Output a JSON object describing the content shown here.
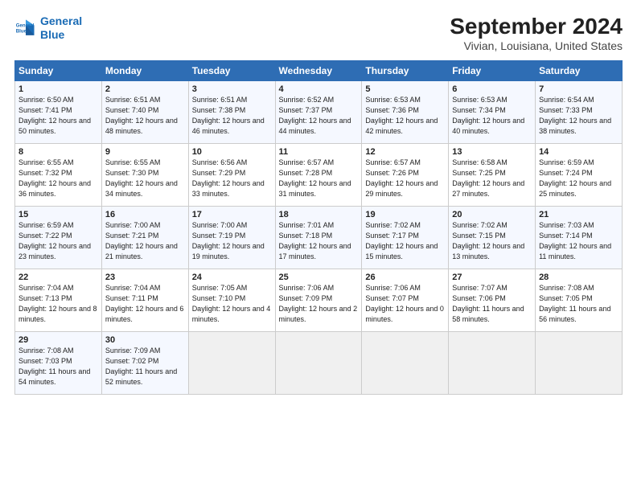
{
  "logo": {
    "line1": "General",
    "line2": "Blue"
  },
  "title": "September 2024",
  "subtitle": "Vivian, Louisiana, United States",
  "weekdays": [
    "Sunday",
    "Monday",
    "Tuesday",
    "Wednesday",
    "Thursday",
    "Friday",
    "Saturday"
  ],
  "weeks": [
    [
      {
        "day": "1",
        "sunrise": "6:50 AM",
        "sunset": "7:41 PM",
        "daylight": "12 hours and 50 minutes."
      },
      {
        "day": "2",
        "sunrise": "6:51 AM",
        "sunset": "7:40 PM",
        "daylight": "12 hours and 48 minutes."
      },
      {
        "day": "3",
        "sunrise": "6:51 AM",
        "sunset": "7:38 PM",
        "daylight": "12 hours and 46 minutes."
      },
      {
        "day": "4",
        "sunrise": "6:52 AM",
        "sunset": "7:37 PM",
        "daylight": "12 hours and 44 minutes."
      },
      {
        "day": "5",
        "sunrise": "6:53 AM",
        "sunset": "7:36 PM",
        "daylight": "12 hours and 42 minutes."
      },
      {
        "day": "6",
        "sunrise": "6:53 AM",
        "sunset": "7:34 PM",
        "daylight": "12 hours and 40 minutes."
      },
      {
        "day": "7",
        "sunrise": "6:54 AM",
        "sunset": "7:33 PM",
        "daylight": "12 hours and 38 minutes."
      }
    ],
    [
      {
        "day": "8",
        "sunrise": "6:55 AM",
        "sunset": "7:32 PM",
        "daylight": "12 hours and 36 minutes."
      },
      {
        "day": "9",
        "sunrise": "6:55 AM",
        "sunset": "7:30 PM",
        "daylight": "12 hours and 34 minutes."
      },
      {
        "day": "10",
        "sunrise": "6:56 AM",
        "sunset": "7:29 PM",
        "daylight": "12 hours and 33 minutes."
      },
      {
        "day": "11",
        "sunrise": "6:57 AM",
        "sunset": "7:28 PM",
        "daylight": "12 hours and 31 minutes."
      },
      {
        "day": "12",
        "sunrise": "6:57 AM",
        "sunset": "7:26 PM",
        "daylight": "12 hours and 29 minutes."
      },
      {
        "day": "13",
        "sunrise": "6:58 AM",
        "sunset": "7:25 PM",
        "daylight": "12 hours and 27 minutes."
      },
      {
        "day": "14",
        "sunrise": "6:59 AM",
        "sunset": "7:24 PM",
        "daylight": "12 hours and 25 minutes."
      }
    ],
    [
      {
        "day": "15",
        "sunrise": "6:59 AM",
        "sunset": "7:22 PM",
        "daylight": "12 hours and 23 minutes."
      },
      {
        "day": "16",
        "sunrise": "7:00 AM",
        "sunset": "7:21 PM",
        "daylight": "12 hours and 21 minutes."
      },
      {
        "day": "17",
        "sunrise": "7:00 AM",
        "sunset": "7:19 PM",
        "daylight": "12 hours and 19 minutes."
      },
      {
        "day": "18",
        "sunrise": "7:01 AM",
        "sunset": "7:18 PM",
        "daylight": "12 hours and 17 minutes."
      },
      {
        "day": "19",
        "sunrise": "7:02 AM",
        "sunset": "7:17 PM",
        "daylight": "12 hours and 15 minutes."
      },
      {
        "day": "20",
        "sunrise": "7:02 AM",
        "sunset": "7:15 PM",
        "daylight": "12 hours and 13 minutes."
      },
      {
        "day": "21",
        "sunrise": "7:03 AM",
        "sunset": "7:14 PM",
        "daylight": "12 hours and 11 minutes."
      }
    ],
    [
      {
        "day": "22",
        "sunrise": "7:04 AM",
        "sunset": "7:13 PM",
        "daylight": "12 hours and 8 minutes."
      },
      {
        "day": "23",
        "sunrise": "7:04 AM",
        "sunset": "7:11 PM",
        "daylight": "12 hours and 6 minutes."
      },
      {
        "day": "24",
        "sunrise": "7:05 AM",
        "sunset": "7:10 PM",
        "daylight": "12 hours and 4 minutes."
      },
      {
        "day": "25",
        "sunrise": "7:06 AM",
        "sunset": "7:09 PM",
        "daylight": "12 hours and 2 minutes."
      },
      {
        "day": "26",
        "sunrise": "7:06 AM",
        "sunset": "7:07 PM",
        "daylight": "12 hours and 0 minutes."
      },
      {
        "day": "27",
        "sunrise": "7:07 AM",
        "sunset": "7:06 PM",
        "daylight": "11 hours and 58 minutes."
      },
      {
        "day": "28",
        "sunrise": "7:08 AM",
        "sunset": "7:05 PM",
        "daylight": "11 hours and 56 minutes."
      }
    ],
    [
      {
        "day": "29",
        "sunrise": "7:08 AM",
        "sunset": "7:03 PM",
        "daylight": "11 hours and 54 minutes."
      },
      {
        "day": "30",
        "sunrise": "7:09 AM",
        "sunset": "7:02 PM",
        "daylight": "11 hours and 52 minutes."
      },
      null,
      null,
      null,
      null,
      null
    ]
  ]
}
